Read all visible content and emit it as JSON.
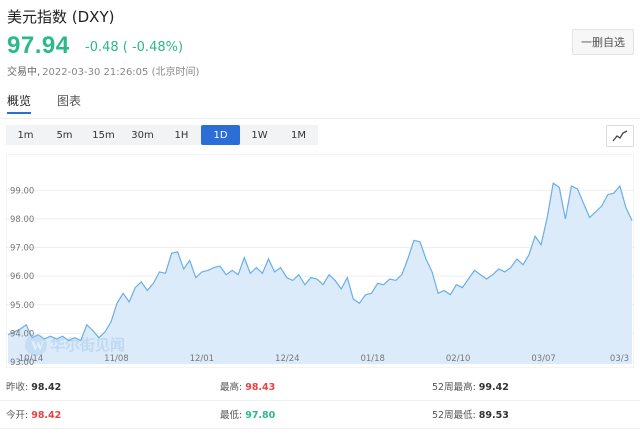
{
  "header": {
    "title": "美元指数 (DXY)",
    "price": "97.94",
    "change": "-0.48 ( -0.48%)",
    "status": "交易中,",
    "timestamp": "2022-03-30 21:26:05 (北京时间)",
    "follow_button": "一删自选"
  },
  "tabs": [
    {
      "label": "概览",
      "active": true
    },
    {
      "label": "图表",
      "active": false
    }
  ],
  "periods": [
    {
      "label": "1m",
      "active": false
    },
    {
      "label": "5m",
      "active": false
    },
    {
      "label": "15m",
      "active": false
    },
    {
      "label": "30m",
      "active": false
    },
    {
      "label": "1H",
      "active": false
    },
    {
      "label": "1D",
      "active": true
    },
    {
      "label": "1W",
      "active": false
    },
    {
      "label": "1M",
      "active": false
    }
  ],
  "chart_type_icon": "line-chart-icon",
  "watermark": "华尔街见闻",
  "colors": {
    "up_green": "#2bb98a",
    "red": "#e84343",
    "accent_blue": "#2b6fd6",
    "line": "#6aaee8",
    "area": "#dcebfa"
  },
  "chart_data": {
    "type": "area",
    "title": "",
    "xlabel": "",
    "ylabel": "",
    "ylim": [
      93.0,
      99.5
    ],
    "yticks": [
      "99.00",
      "98.00",
      "97.00",
      "96.00",
      "95.00",
      "94.00",
      "93.00"
    ],
    "xtick_labels": [
      "10/14",
      "11/08",
      "12/01",
      "12/24",
      "01/18",
      "02/10",
      "03/07",
      "03/3"
    ],
    "grid": true,
    "series": [
      {
        "values": [
          93.95,
          94.05,
          94.15,
          94.3,
          93.85,
          93.95,
          93.8,
          93.9,
          93.8,
          93.9,
          93.75,
          93.85,
          93.75,
          94.3,
          94.1,
          93.85,
          94.05,
          94.4,
          95.05,
          95.4,
          95.1,
          95.6,
          95.8,
          95.5,
          95.75,
          96.15,
          96.1,
          96.8,
          96.85,
          96.25,
          96.55,
          95.95,
          96.15,
          96.2,
          96.3,
          96.35,
          96.05,
          96.2,
          96.05,
          96.65,
          96.1,
          96.3,
          96.1,
          96.6,
          96.15,
          96.3,
          95.95,
          95.85,
          96.05,
          95.7,
          95.95,
          95.9,
          95.7,
          96.05,
          95.85,
          95.55,
          95.95,
          95.2,
          95.05,
          95.35,
          95.4,
          95.75,
          95.7,
          95.9,
          95.85,
          96.05,
          96.6,
          97.25,
          97.2,
          96.6,
          96.15,
          95.4,
          95.5,
          95.35,
          95.7,
          95.6,
          95.9,
          96.2,
          96.05,
          95.9,
          96.05,
          96.25,
          96.15,
          96.3,
          96.6,
          96.4,
          96.75,
          97.4,
          97.1,
          98.05,
          99.25,
          99.1,
          98.0,
          99.15,
          99.05,
          98.55,
          98.05,
          98.25,
          98.45,
          98.85,
          98.9,
          99.15,
          98.4,
          97.94
        ]
      }
    ]
  },
  "stats": {
    "rows": [
      [
        {
          "label": "昨收:",
          "value": "98.42",
          "tone": "dark"
        },
        {
          "label": "最高:",
          "value": "98.43",
          "tone": "red"
        },
        {
          "label": "52周最高:",
          "value": "99.42",
          "tone": "dark"
        }
      ],
      [
        {
          "label": "今开:",
          "value": "98.42",
          "tone": "red"
        },
        {
          "label": "最低:",
          "value": "97.80",
          "tone": "green"
        },
        {
          "label": "52周最低:",
          "value": "89.53",
          "tone": "dark"
        }
      ]
    ]
  }
}
